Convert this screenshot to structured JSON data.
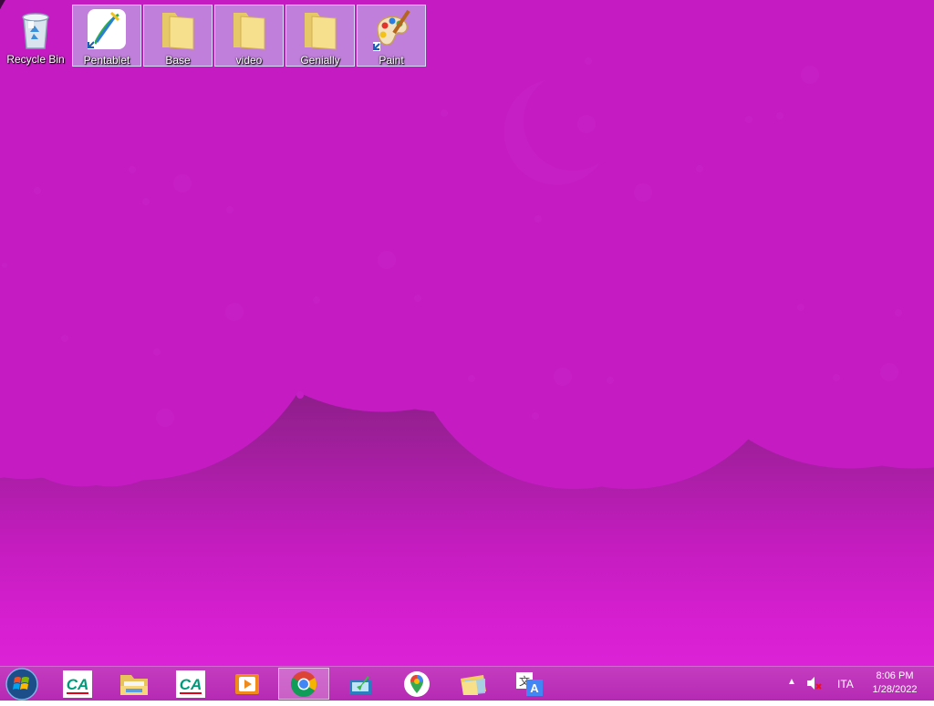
{
  "desktop": {
    "icons": [
      {
        "label": "Recycle Bin",
        "icon": "recycle-bin-icon"
      },
      {
        "label": "Pentablet",
        "icon": "pentablet-icon"
      },
      {
        "label": "Base",
        "icon": "folder-icon"
      },
      {
        "label": "video",
        "icon": "folder-icon"
      },
      {
        "label": "Genially",
        "icon": "folder-icon"
      },
      {
        "label": "Paint",
        "icon": "paint-icon"
      }
    ]
  },
  "taskbar": {
    "apps": [
      {
        "name": "credit-agricole-app",
        "icon": "credit-agricole-icon"
      },
      {
        "name": "file-explorer",
        "icon": "file-explorer-icon"
      },
      {
        "name": "credit-agricole-app-2",
        "icon": "credit-agricole-icon"
      },
      {
        "name": "video-player",
        "icon": "video-player-icon"
      },
      {
        "name": "chrome",
        "icon": "chrome-icon",
        "active": true
      },
      {
        "name": "screen-capture",
        "icon": "screen-capture-icon"
      },
      {
        "name": "maps",
        "icon": "maps-pin-icon"
      },
      {
        "name": "folders",
        "icon": "folders-icon"
      },
      {
        "name": "translator",
        "icon": "translate-icon"
      }
    ],
    "tray": {
      "language": "ITA",
      "time": "8:06 PM",
      "date": "1/28/2022"
    }
  },
  "colors": {
    "wallpaper_top": "#3c0a3e",
    "wallpaper_bottom": "#dc22d6",
    "shapes": "#c71fc6",
    "taskbar": "#b62ab3"
  }
}
